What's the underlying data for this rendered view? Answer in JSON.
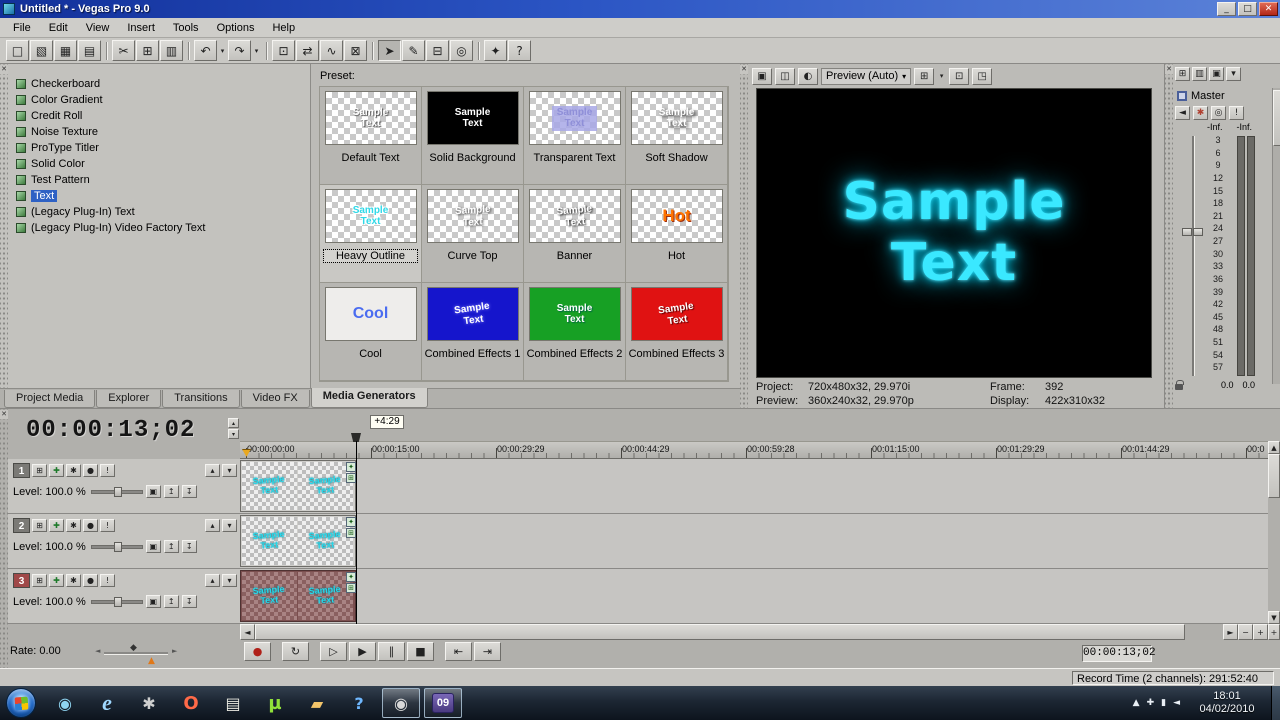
{
  "colors": {
    "accent_blue": "#2e61c4",
    "sample_text_cyan": "#3ae8ff",
    "record_red": "#b02018",
    "track3_maroon": "#7b4f4f"
  },
  "glyphs": {
    "left": "◄",
    "right": "►",
    "up": "▲",
    "down": "▼",
    "small_up": "▴",
    "small_down": "▾",
    "dropdown": "▾",
    "minus": "−",
    "plus": "+",
    "close": "✕",
    "diamond": "◆",
    "generated_media": "✦",
    "pan_crop": "⊞"
  },
  "titlebar": {
    "title": "Untitled * - Vegas Pro 9.0",
    "minimize": "_",
    "maximize": "□",
    "close": "✕"
  },
  "menu": {
    "items": [
      "File",
      "Edit",
      "View",
      "Insert",
      "Tools",
      "Options",
      "Help"
    ]
  },
  "toolbar": {
    "buttons": [
      {
        "name": "new-project",
        "glyph": "□"
      },
      {
        "name": "open",
        "glyph": "▧"
      },
      {
        "name": "save",
        "glyph": "▦"
      },
      {
        "name": "project-properties",
        "glyph": "▤"
      },
      {
        "name": "cut",
        "glyph": "✂"
      },
      {
        "name": "copy",
        "glyph": "⊞"
      },
      {
        "name": "paste",
        "glyph": "▥"
      },
      {
        "name": "undo",
        "glyph": "↶"
      },
      {
        "name": "redo",
        "glyph": "↷"
      },
      {
        "name": "enable-snapping",
        "glyph": "⊡"
      },
      {
        "name": "auto-ripple",
        "glyph": "⇄"
      },
      {
        "name": "lock-envelopes",
        "glyph": "∿"
      },
      {
        "name": "ignore-event-grouping",
        "glyph": "⊠"
      },
      {
        "name": "normal-edit-tool",
        "glyph": "➤"
      },
      {
        "name": "envelope-edit-tool",
        "glyph": "✎"
      },
      {
        "name": "selection-edit-tool",
        "glyph": "⊟"
      },
      {
        "name": "zoom-edit-tool",
        "glyph": "◎"
      },
      {
        "name": "interactive-tutorials",
        "glyph": "✦"
      },
      {
        "name": "whats-this-help",
        "glyph": "?"
      }
    ]
  },
  "generator_list": {
    "items": [
      "Checkerboard",
      "Color Gradient",
      "Credit Roll",
      "Noise Texture",
      "ProType Titler",
      "Solid Color",
      "Test Pattern",
      "Text",
      "(Legacy Plug-In) Text",
      "(Legacy Plug-In) Video Factory Text"
    ],
    "selected": "Text"
  },
  "preset_panel": {
    "label": "Preset:",
    "presets": [
      {
        "name": "Default Text",
        "sample": "Sample\nText"
      },
      {
        "name": "Solid Background",
        "sample": "Sample\nText"
      },
      {
        "name": "Transparent Text",
        "sample": "Sample\nText"
      },
      {
        "name": "Soft Shadow",
        "sample": "Sample\nText"
      },
      {
        "name": "Heavy Outline",
        "sample": "Sample\nText"
      },
      {
        "name": "Curve Top",
        "sample": "Sample\nText"
      },
      {
        "name": "Banner",
        "sample": "Sample\nText"
      },
      {
        "name": "Hot",
        "sample": "Hot"
      },
      {
        "name": "Cool",
        "sample": "Cool"
      },
      {
        "name": "Combined Effects 1",
        "sample": "Sample\nText"
      },
      {
        "name": "Combined Effects 2",
        "sample": "Sample\nText"
      },
      {
        "name": "Combined Effects 3",
        "sample": "Sample\nText"
      }
    ]
  },
  "tabs": {
    "items": [
      "Project Media",
      "Explorer",
      "Transitions",
      "Video FX",
      "Media Generators"
    ],
    "active": "Media Generators"
  },
  "preview_header": {
    "buttons": [
      {
        "name": "project-video-properties",
        "glyph": "▣"
      },
      {
        "name": "split-screen-view",
        "glyph": "◫"
      },
      {
        "name": "preview-quality",
        "glyph": "◐"
      },
      {
        "name": "overlays",
        "glyph": "⊞"
      },
      {
        "name": "copy-snapshot",
        "glyph": "⊡"
      },
      {
        "name": "save-snapshot",
        "glyph": "◳"
      }
    ]
  },
  "preview": {
    "quality": "Preview (Auto)",
    "video_line1": "Sample",
    "video_line2": "Text",
    "project_label": "Project:",
    "project_value": "720x480x32, 29.970i",
    "frame_label": "Frame:",
    "frame_value": "392",
    "preview_label": "Preview:",
    "preview_value": "360x240x32, 29.970p",
    "display_label": "Display:",
    "display_value": "422x310x32"
  },
  "master_header": {
    "buttons": [
      {
        "name": "insert-assignable-fx",
        "glyph": "⊞"
      },
      {
        "name": "insert-bus",
        "glyph": "▥"
      },
      {
        "name": "master-properties",
        "glyph": "▣"
      },
      {
        "name": "more-options",
        "glyph": "▾"
      }
    ]
  },
  "master_controls": {
    "buttons": [
      {
        "name": "mute-output",
        "glyph": "◄"
      },
      {
        "name": "master-fx",
        "glyph": "✱"
      },
      {
        "name": "downmix-output",
        "glyph": "◎"
      },
      {
        "name": "dim-output",
        "glyph": "!"
      }
    ]
  },
  "master": {
    "label": "Master",
    "inf_left": "-Inf.",
    "inf_right": "-Inf.",
    "scale": "3\n6\n9\n12\n15\n18\n21\n24\n27\n30\n33\n36\n39\n42\n45\n48\n51\n54\n57",
    "value_left": "0.0",
    "value_right": "0.0"
  },
  "track_buttons": [
    {
      "name": "track-motion",
      "glyph": "⊞"
    },
    {
      "name": "track-fx",
      "glyph": "✚"
    },
    {
      "name": "automation-settings",
      "glyph": "✱"
    },
    {
      "name": "mute",
      "glyph": "●"
    },
    {
      "name": "solo",
      "glyph": "!"
    },
    {
      "name": "composite-mode",
      "glyph": "▣"
    },
    {
      "name": "make-compositing-child",
      "glyph": "↥"
    },
    {
      "name": "remove-compositing-child",
      "glyph": "↧"
    }
  ],
  "timeline": {
    "timecode": "00:00:13;02",
    "cursor_offset": "+4:29",
    "ruler_labels": [
      "00:00:00:00",
      "00:00:15:00",
      "00:00:29:29",
      "00:00:44:29",
      "00:00:59:28",
      "00:01:15:00",
      "00:01:29:29",
      "00:01:44:29",
      "00:0"
    ],
    "tracks": [
      {
        "number": "1",
        "level_label": "Level:",
        "level_value": "100.0 %",
        "clip_text": "Sample\nText"
      },
      {
        "number": "2",
        "level_label": "Level:",
        "level_value": "100.0 %",
        "clip_text": "Sample\nText"
      },
      {
        "number": "3",
        "level_label": "Level:",
        "level_value": "100.0 %",
        "clip_text": "Sample\nText"
      }
    ],
    "rate_label": "Rate:",
    "rate_value": "0.00",
    "cursor_timecode": "00:00:13;02"
  },
  "transport": {
    "buttons": [
      {
        "name": "record",
        "glyph": "●"
      },
      {
        "name": "loop-playback",
        "glyph": "↻"
      },
      {
        "name": "play-from-start",
        "glyph": "▷"
      },
      {
        "name": "play",
        "glyph": "▶"
      },
      {
        "name": "pause",
        "glyph": "∥"
      },
      {
        "name": "stop",
        "glyph": "■"
      },
      {
        "name": "go-to-start",
        "glyph": "⇤"
      },
      {
        "name": "go-to-end",
        "glyph": "⇥"
      }
    ]
  },
  "status_bar": {
    "record_time": "Record Time (2 channels): 291:52:40"
  },
  "taskbar": {
    "apps": [
      {
        "name": "media-player",
        "glyph": "◉"
      },
      {
        "name": "internet-explorer",
        "glyph": "e"
      },
      {
        "name": "system-tool",
        "glyph": "✱"
      },
      {
        "name": "browser",
        "glyph": "O"
      },
      {
        "name": "notepad",
        "glyph": "▤"
      },
      {
        "name": "utorrent",
        "glyph": "µ"
      },
      {
        "name": "folder",
        "glyph": "▰"
      },
      {
        "name": "help-viewer",
        "glyph": "?"
      },
      {
        "name": "screen-capture",
        "glyph": "◉"
      },
      {
        "name": "vegas-pro",
        "glyph": "09"
      }
    ],
    "tray": [
      {
        "name": "tray-expand",
        "glyph": "▲"
      },
      {
        "name": "action-center",
        "glyph": "✚"
      },
      {
        "name": "network",
        "glyph": "▮"
      },
      {
        "name": "volume",
        "glyph": "◄"
      }
    ],
    "time": "18:01",
    "date": "04/02/2010"
  }
}
